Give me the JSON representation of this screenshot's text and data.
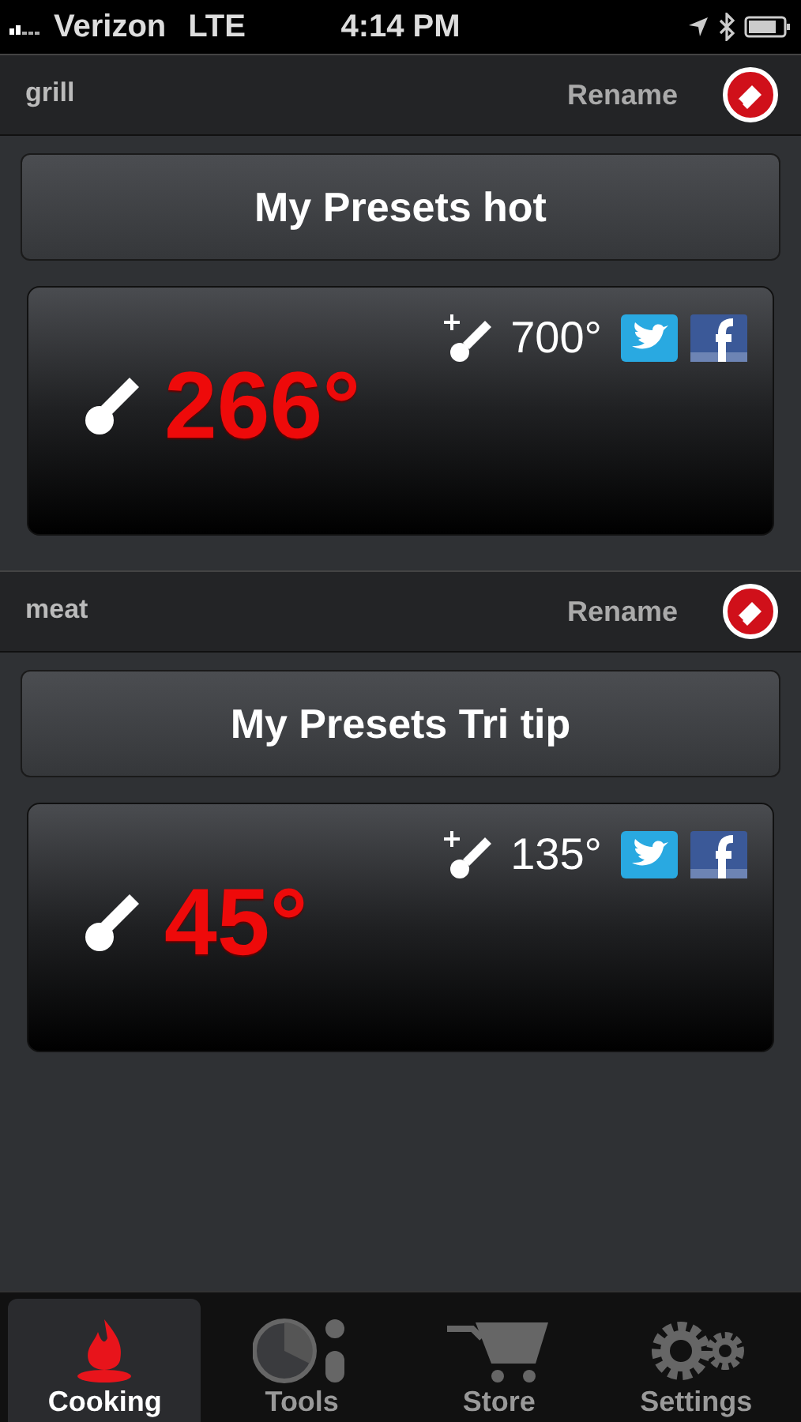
{
  "status_bar": {
    "carrier": "Verizon",
    "network": "LTE",
    "time": "4:14 PM"
  },
  "probes": [
    {
      "name": "grill",
      "rename": "Rename",
      "preset": "My Presets hot",
      "temperature": "266°",
      "target": "700°"
    },
    {
      "name": "meat",
      "rename": "Rename",
      "preset": "My Presets Tri tip",
      "temperature": "45°",
      "target": "135°"
    }
  ],
  "tabs": [
    {
      "label": "Cooking",
      "kind": "flame",
      "selected": true
    },
    {
      "label": "Tools",
      "kind": "timer",
      "selected": false
    },
    {
      "label": "Store",
      "kind": "cart",
      "selected": false
    },
    {
      "label": "Settings",
      "kind": "gears",
      "selected": false
    }
  ]
}
